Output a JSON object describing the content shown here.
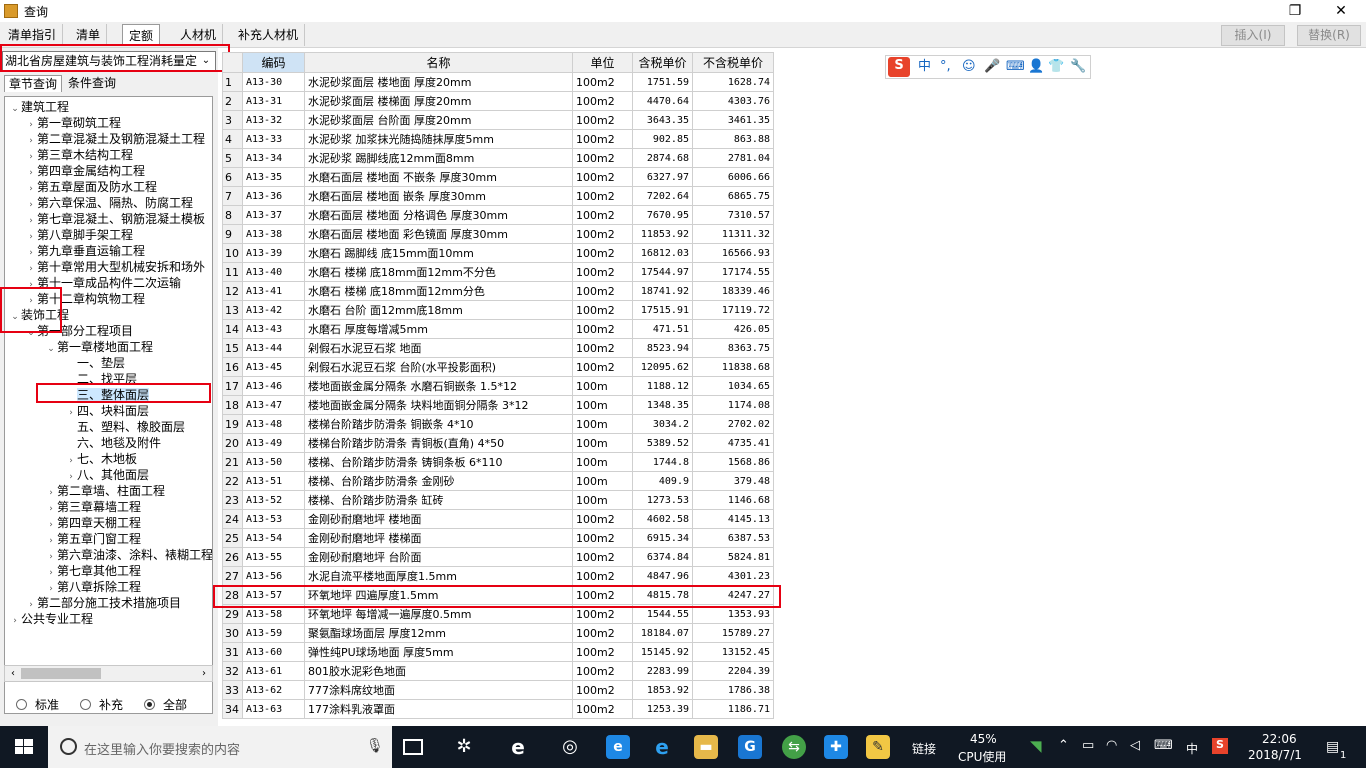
{
  "window": {
    "title": "查询",
    "restore_glyph": "❐",
    "close_glyph": "✕"
  },
  "toolbar": {
    "tabs": [
      "清单指引",
      "清单",
      "定额",
      "人材机",
      "补充人材机"
    ],
    "active_tab": "定额",
    "insert_label": "插入(I)",
    "replace_label": "替换(R)"
  },
  "left": {
    "dropdown_value": "湖北省房屋建筑与装饰工程消耗量定",
    "subtabs": [
      "章节查询",
      "条件查询"
    ],
    "tree": [
      {
        "label": "建筑工程",
        "level": 0,
        "toggle": "open"
      },
      {
        "label": "第一章砌筑工程",
        "level": 1,
        "toggle": "closed"
      },
      {
        "label": "第二章混凝土及钢筋混凝土工程",
        "level": 1,
        "toggle": "closed"
      },
      {
        "label": "第三章木结构工程",
        "level": 1,
        "toggle": "closed"
      },
      {
        "label": "第四章金属结构工程",
        "level": 1,
        "toggle": "closed"
      },
      {
        "label": "第五章屋面及防水工程",
        "level": 1,
        "toggle": "closed"
      },
      {
        "label": "第六章保温、隔热、防腐工程",
        "level": 1,
        "toggle": "closed"
      },
      {
        "label": "第七章混凝土、钢筋混凝土模板",
        "level": 1,
        "toggle": "closed"
      },
      {
        "label": "第八章脚手架工程",
        "level": 1,
        "toggle": "closed"
      },
      {
        "label": "第九章垂直运输工程",
        "level": 1,
        "toggle": "closed"
      },
      {
        "label": "第十章常用大型机械安拆和场外",
        "level": 1,
        "toggle": "closed"
      },
      {
        "label": "第十一章成品构件二次运输",
        "level": 1,
        "toggle": "closed"
      },
      {
        "label": "第十二章构筑物工程",
        "level": 1,
        "toggle": "closed"
      },
      {
        "label": "装饰工程",
        "level": 0,
        "toggle": "open"
      },
      {
        "label": "第一部分工程项目",
        "level": 1,
        "toggle": "open"
      },
      {
        "label": "第一章楼地面工程",
        "level": 2,
        "toggle": "open"
      },
      {
        "label": "一、垫层",
        "level": 3,
        "toggle": ""
      },
      {
        "label": "二、找平层",
        "level": 3,
        "toggle": ""
      },
      {
        "label": "三、整体面层",
        "level": 3,
        "toggle": "",
        "selected": true
      },
      {
        "label": "四、块料面层",
        "level": 3,
        "toggle": "closed"
      },
      {
        "label": "五、塑料、橡胶面层",
        "level": 3,
        "toggle": ""
      },
      {
        "label": "六、地毯及附件",
        "level": 3,
        "toggle": ""
      },
      {
        "label": "七、木地板",
        "level": 3,
        "toggle": "closed"
      },
      {
        "label": "八、其他面层",
        "level": 3,
        "toggle": "closed"
      },
      {
        "label": "第二章墙、柱面工程",
        "level": 2,
        "toggle": "closed"
      },
      {
        "label": "第三章幕墙工程",
        "level": 2,
        "toggle": "closed"
      },
      {
        "label": "第四章天棚工程",
        "level": 2,
        "toggle": "closed"
      },
      {
        "label": "第五章门窗工程",
        "level": 2,
        "toggle": "closed"
      },
      {
        "label": "第六章油漆、涂料、裱糊工程",
        "level": 2,
        "toggle": "closed"
      },
      {
        "label": "第七章其他工程",
        "level": 2,
        "toggle": "closed"
      },
      {
        "label": "第八章拆除工程",
        "level": 2,
        "toggle": "closed"
      },
      {
        "label": "第二部分施工技术措施项目",
        "level": 1,
        "toggle": "closed"
      },
      {
        "label": "公共专业工程",
        "level": 0,
        "toggle": "closed"
      }
    ],
    "radios": [
      {
        "label": "标准",
        "checked": false
      },
      {
        "label": "补充",
        "checked": false
      },
      {
        "label": "全部",
        "checked": true
      }
    ]
  },
  "table": {
    "headers": [
      "",
      "编码",
      "名称",
      "单位",
      "含税单价",
      "不含税单价"
    ],
    "rows": [
      [
        "1",
        "A13-30",
        "水泥砂浆面层 楼地面 厚度20mm",
        "100m2",
        "1751.59",
        "1628.74"
      ],
      [
        "2",
        "A13-31",
        "水泥砂浆面层 楼梯面 厚度20mm",
        "100m2",
        "4470.64",
        "4303.76"
      ],
      [
        "3",
        "A13-32",
        "水泥砂浆面层 台阶面 厚度20mm",
        "100m2",
        "3643.35",
        "3461.35"
      ],
      [
        "4",
        "A13-33",
        "水泥砂浆 加浆抹光随捣随抹厚度5mm",
        "100m2",
        "902.85",
        "863.88"
      ],
      [
        "5",
        "A13-34",
        "水泥砂浆 踢脚线底12mm面8mm",
        "100m2",
        "2874.68",
        "2781.04"
      ],
      [
        "6",
        "A13-35",
        "水磨石面层 楼地面 不嵌条 厚度30mm",
        "100m2",
        "6327.97",
        "6006.66"
      ],
      [
        "7",
        "A13-36",
        "水磨石面层 楼地面 嵌条 厚度30mm",
        "100m2",
        "7202.64",
        "6865.75"
      ],
      [
        "8",
        "A13-37",
        "水磨石面层 楼地面 分格调色 厚度30mm",
        "100m2",
        "7670.95",
        "7310.57"
      ],
      [
        "9",
        "A13-38",
        "水磨石面层 楼地面 彩色镜面 厚度30mm",
        "100m2",
        "11853.92",
        "11311.32"
      ],
      [
        "10",
        "A13-39",
        "水磨石 踢脚线 底15mm面10mm",
        "100m2",
        "16812.03",
        "16566.93"
      ],
      [
        "11",
        "A13-40",
        "水磨石 楼梯 底18mm面12mm不分色",
        "100m2",
        "17544.97",
        "17174.55"
      ],
      [
        "12",
        "A13-41",
        "水磨石 楼梯 底18mm面12mm分色",
        "100m2",
        "18741.92",
        "18339.46"
      ],
      [
        "13",
        "A13-42",
        "水磨石 台阶 面12mm底18mm",
        "100m2",
        "17515.91",
        "17119.72"
      ],
      [
        "14",
        "A13-43",
        "水磨石 厚度每增减5mm",
        "100m2",
        "471.51",
        "426.05"
      ],
      [
        "15",
        "A13-44",
        "剁假石水泥豆石浆 地面",
        "100m2",
        "8523.94",
        "8363.75"
      ],
      [
        "16",
        "A13-45",
        "剁假石水泥豆石浆 台阶(水平投影面积)",
        "100m2",
        "12095.62",
        "11838.68"
      ],
      [
        "17",
        "A13-46",
        "楼地面嵌金属分隔条 水磨石铜嵌条 1.5*12",
        "100m",
        "1188.12",
        "1034.65"
      ],
      [
        "18",
        "A13-47",
        "楼地面嵌金属分隔条 块料地面铜分隔条 3*12",
        "100m",
        "1348.35",
        "1174.08"
      ],
      [
        "19",
        "A13-48",
        "楼梯台阶踏步防滑条 铜嵌条 4*10",
        "100m",
        "3034.2",
        "2702.02"
      ],
      [
        "20",
        "A13-49",
        "楼梯台阶踏步防滑条 青铜板(直角) 4*50",
        "100m",
        "5389.52",
        "4735.41"
      ],
      [
        "21",
        "A13-50",
        "楼梯、台阶踏步防滑条 铸铜条板 6*110",
        "100m",
        "1744.8",
        "1568.86"
      ],
      [
        "22",
        "A13-51",
        "楼梯、台阶踏步防滑条 金刚砂",
        "100m",
        "409.9",
        "379.48"
      ],
      [
        "23",
        "A13-52",
        "楼梯、台阶踏步防滑条 缸砖",
        "100m",
        "1273.53",
        "1146.68"
      ],
      [
        "24",
        "A13-53",
        "金刚砂耐磨地坪 楼地面",
        "100m2",
        "4602.58",
        "4145.13"
      ],
      [
        "25",
        "A13-54",
        "金刚砂耐磨地坪 楼梯面",
        "100m2",
        "6915.34",
        "6387.53"
      ],
      [
        "26",
        "A13-55",
        "金刚砂耐磨地坪 台阶面",
        "100m2",
        "6374.84",
        "5824.81"
      ],
      [
        "27",
        "A13-56",
        "水泥自流平楼地面厚度1.5mm",
        "100m2",
        "4847.96",
        "4301.23"
      ],
      [
        "28",
        "A13-57",
        "环氧地坪 四遍厚度1.5mm",
        "100m2",
        "4815.78",
        "4247.27"
      ],
      [
        "29",
        "A13-58",
        "环氧地坪 每增减一遍厚度0.5mm",
        "100m2",
        "1544.55",
        "1353.93"
      ],
      [
        "30",
        "A13-59",
        "聚氨酯球场面层 厚度12mm",
        "100m2",
        "18184.07",
        "15789.27"
      ],
      [
        "31",
        "A13-60",
        "弹性纯PU球场地面 厚度5mm",
        "100m2",
        "15145.92",
        "13152.45"
      ],
      [
        "32",
        "A13-61",
        "801胶水泥彩色地面",
        "100m2",
        "2283.99",
        "2204.39"
      ],
      [
        "33",
        "A13-62",
        "777涂料席纹地面",
        "100m2",
        "1853.92",
        "1786.38"
      ],
      [
        "34",
        "A13-63",
        "177涂料乳液罩面",
        "100m2",
        "1253.39",
        "1186.71"
      ]
    ]
  },
  "ime": {
    "logo": "S",
    "items": [
      "中",
      "°,",
      "☺",
      "🎤",
      "⌨",
      "👤",
      "👕",
      "🔧"
    ]
  },
  "taskbar": {
    "search_placeholder": "在这里输入你要搜索的内容",
    "link_label": "链接",
    "cpu_percent": "45%",
    "cpu_label": "CPU使用",
    "lang": "中",
    "time": "22:06",
    "date": "2018/7/1",
    "notif_count": "1"
  },
  "colors": {
    "highlight_box": "#e60012",
    "taskbar": "#101823",
    "selected_code_header": "#cfe3f5"
  }
}
